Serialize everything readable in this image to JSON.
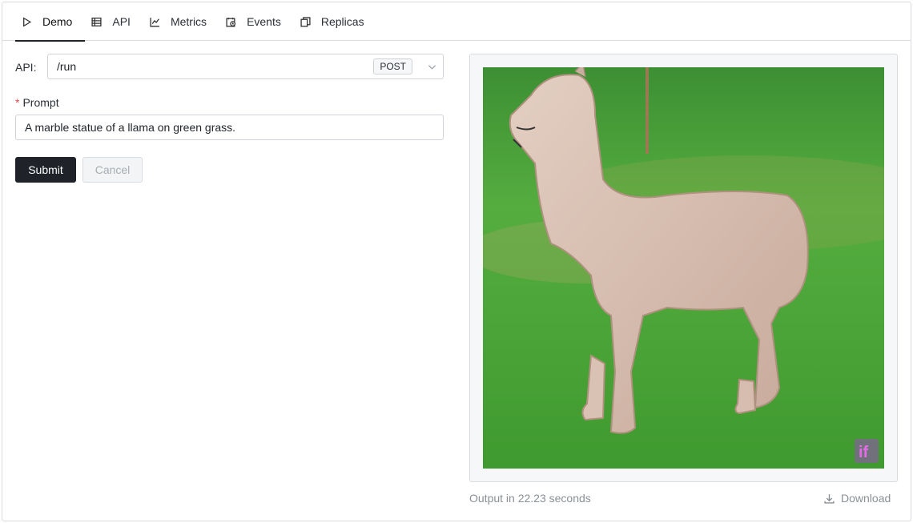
{
  "tabs": [
    {
      "label": "Demo",
      "icon": "play-icon",
      "active": true
    },
    {
      "label": "API",
      "icon": "table-icon",
      "active": false
    },
    {
      "label": "Metrics",
      "icon": "line-chart-icon",
      "active": false
    },
    {
      "label": "Events",
      "icon": "calendar-clock-icon",
      "active": false
    },
    {
      "label": "Replicas",
      "icon": "copy-icon",
      "active": false
    }
  ],
  "form": {
    "api_label": "API:",
    "api_value": "/run",
    "method": "POST",
    "prompt_required_marker": "*",
    "prompt_label": "Prompt",
    "prompt_value": "A marble statue of a llama on green grass.",
    "submit_label": "Submit",
    "cancel_label": "Cancel"
  },
  "output": {
    "image_alt": "Generated image",
    "watermark": "if",
    "time_text": "Output in 22.23 seconds",
    "download_label": "Download"
  },
  "colors": {
    "primary_button": "#1f2228",
    "required": "#e5484d",
    "muted_text": "#8a9097"
  }
}
